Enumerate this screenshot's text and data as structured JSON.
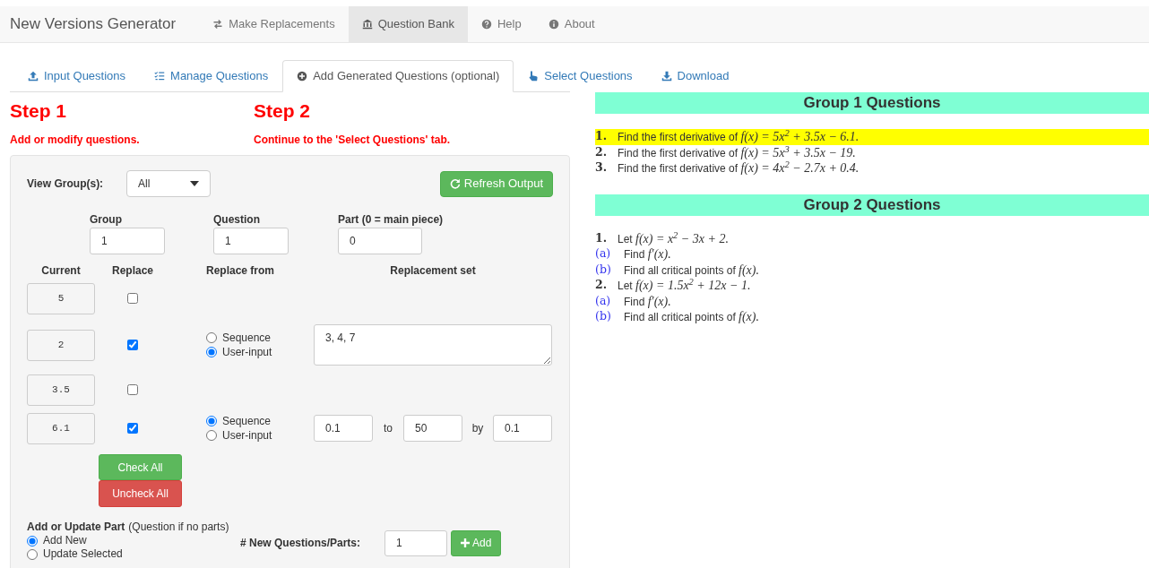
{
  "navbar": {
    "brand": "New Versions Generator",
    "items": [
      {
        "label": "Make Replacements",
        "selected": false
      },
      {
        "label": "Question Bank",
        "selected": true
      },
      {
        "label": "Help",
        "selected": false
      },
      {
        "label": "About",
        "selected": false
      }
    ]
  },
  "tabs": [
    {
      "label": "Input Questions",
      "selected": false
    },
    {
      "label": "Manage Questions",
      "selected": false
    },
    {
      "label": "Add Generated Questions (optional)",
      "selected": true
    },
    {
      "label": "Select Questions",
      "selected": false
    },
    {
      "label": "Download",
      "selected": false
    }
  ],
  "steps": [
    {
      "title": "Step 1",
      "note": "Add or modify questions."
    },
    {
      "title": "Step 2",
      "note": "Continue to the 'Select Questions' tab."
    }
  ],
  "panel": {
    "view_label": "View Group(s):",
    "view_value": "All",
    "refresh_button": "Refresh Output",
    "fields": [
      {
        "label": "Group",
        "value": "1"
      },
      {
        "label": "Question",
        "value": "1"
      },
      {
        "label": "Part (0 = main piece)",
        "value": "0"
      }
    ],
    "columns": [
      "Current",
      "Replace",
      "Replace from",
      "Replacement set"
    ],
    "rows": [
      {
        "current": "5",
        "checked": false
      },
      {
        "current": "2",
        "checked": true,
        "options": [
          {
            "label": "Sequence",
            "selected": false
          },
          {
            "label": "User-input",
            "selected": true
          }
        ],
        "set": {
          "kind": "text",
          "value": "3, 4, 7"
        }
      },
      {
        "current": "3.5",
        "checked": false
      },
      {
        "current": "6.1",
        "checked": true,
        "options": [
          {
            "label": "Sequence",
            "selected": true
          },
          {
            "label": "User-input",
            "selected": false
          }
        ],
        "set": {
          "kind": "range",
          "from": "0.1",
          "to_label": "to",
          "to": "50",
          "by_label": "by",
          "by": "0.1"
        }
      }
    ],
    "check_all": "Check All",
    "uncheck_all": "Uncheck All",
    "mode_label": "Add or Update Part",
    "mode_note": "(Question if no parts)",
    "modes": [
      {
        "label": "Add New",
        "selected": true
      },
      {
        "label": "Update Selected",
        "selected": false
      }
    ],
    "count_label": "# New Questions/Parts:",
    "count_value": "1",
    "add_button": "Add"
  },
  "groups": [
    {
      "title": "Group 1 Questions",
      "items": [
        {
          "kind": "question",
          "marker": "1.",
          "text": "Find the first derivative of",
          "math": "f(x) = 5x$^{2}$ + 3.5x − 6.1.",
          "highlighted": true
        },
        {
          "kind": "question",
          "marker": "2.",
          "text": "Find the first derivative of",
          "math": "f(x) = 5x$^{3}$ + 3.5x − 19.",
          "highlighted": false
        },
        {
          "kind": "question",
          "marker": "3.",
          "text": "Find the first derivative of",
          "math": "f(x) = 4x$^{2}$ − 2.7x + 0.4.",
          "highlighted": false
        }
      ]
    },
    {
      "title": "Group 2 Questions",
      "items": [
        {
          "kind": "question",
          "marker": "1.",
          "text": "Let",
          "math": "f(x) = x$^{2}$ − 3x + 2.",
          "highlighted": false
        },
        {
          "kind": "part",
          "marker": "(a)",
          "text": "Find",
          "math": "f′(x).",
          "highlighted": false
        },
        {
          "kind": "part",
          "marker": "(b)",
          "text": "Find all critical points of",
          "math": "f(x).",
          "highlighted": false
        },
        {
          "kind": "question",
          "marker": "2.",
          "text": "Let",
          "math": "f(x) = 1.5x$^{2}$ + 12x − 1.",
          "highlighted": false
        },
        {
          "kind": "part",
          "marker": "(a)",
          "text": "Find",
          "math": "f′(x).",
          "highlighted": false
        },
        {
          "kind": "part",
          "marker": "(b)",
          "text": "Find all critical points of",
          "math": "f(x).",
          "highlighted": false
        }
      ]
    }
  ]
}
